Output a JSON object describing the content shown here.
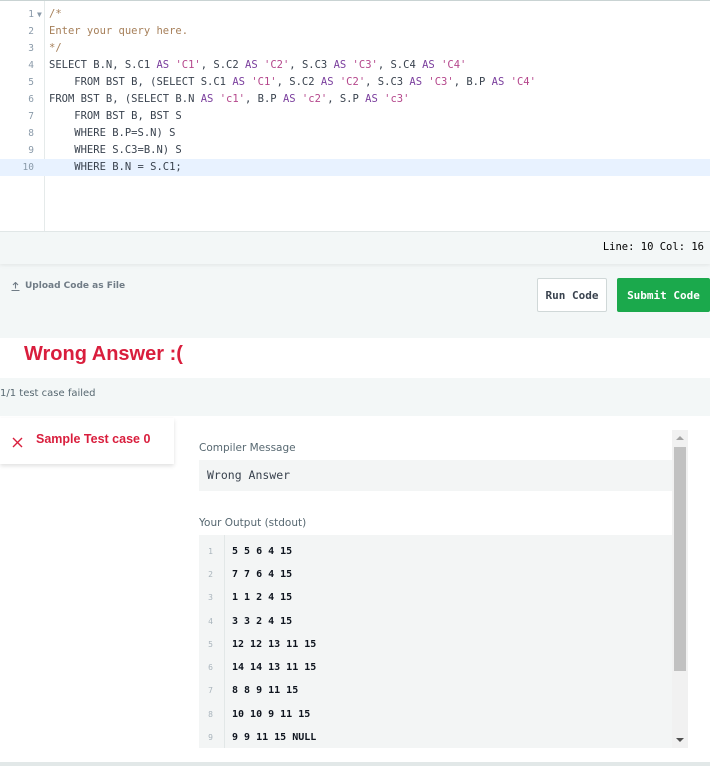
{
  "editor": {
    "lines": [
      {
        "num": "1",
        "segments": [
          {
            "t": "/*",
            "c": "comment"
          }
        ]
      },
      {
        "num": "2",
        "segments": [
          {
            "t": "Enter your query here.",
            "c": "comment"
          }
        ]
      },
      {
        "num": "3",
        "segments": [
          {
            "t": "*/",
            "c": "comment"
          }
        ]
      },
      {
        "num": "4",
        "segments": [
          {
            "t": "SELECT B.N, S.C1 ",
            "c": "kw"
          },
          {
            "t": "AS",
            "c": "kw2"
          },
          {
            "t": " ",
            "c": "kw"
          },
          {
            "t": "'C1'",
            "c": "str"
          },
          {
            "t": ", S.C2 ",
            "c": "kw"
          },
          {
            "t": "AS",
            "c": "kw2"
          },
          {
            "t": " ",
            "c": "kw"
          },
          {
            "t": "'C2'",
            "c": "str"
          },
          {
            "t": ", S.C3 ",
            "c": "kw"
          },
          {
            "t": "AS",
            "c": "kw2"
          },
          {
            "t": " ",
            "c": "kw"
          },
          {
            "t": "'C3'",
            "c": "str"
          },
          {
            "t": ", S.C4 ",
            "c": "kw"
          },
          {
            "t": "AS",
            "c": "kw2"
          },
          {
            "t": " ",
            "c": "kw"
          },
          {
            "t": "'C4'",
            "c": "str"
          }
        ]
      },
      {
        "num": "5",
        "segments": [
          {
            "t": "    FROM BST B, (SELECT S.C1 ",
            "c": "kw"
          },
          {
            "t": "AS",
            "c": "kw2"
          },
          {
            "t": " ",
            "c": "kw"
          },
          {
            "t": "'C1'",
            "c": "str"
          },
          {
            "t": ", S.C2 ",
            "c": "kw"
          },
          {
            "t": "AS",
            "c": "kw2"
          },
          {
            "t": " ",
            "c": "kw"
          },
          {
            "t": "'C2'",
            "c": "str"
          },
          {
            "t": ", S.C3 ",
            "c": "kw"
          },
          {
            "t": "AS",
            "c": "kw2"
          },
          {
            "t": " ",
            "c": "kw"
          },
          {
            "t": "'C3'",
            "c": "str"
          },
          {
            "t": ", B.P ",
            "c": "kw"
          },
          {
            "t": "AS",
            "c": "kw2"
          },
          {
            "t": " ",
            "c": "kw"
          },
          {
            "t": "'C4'",
            "c": "str"
          }
        ]
      },
      {
        "num": "6",
        "segments": [
          {
            "t": "FROM BST B, (SELECT B.N ",
            "c": "kw"
          },
          {
            "t": "AS",
            "c": "kw2"
          },
          {
            "t": " ",
            "c": "kw"
          },
          {
            "t": "'c1'",
            "c": "str"
          },
          {
            "t": ", B.P ",
            "c": "kw"
          },
          {
            "t": "AS",
            "c": "kw2"
          },
          {
            "t": " ",
            "c": "kw"
          },
          {
            "t": "'c2'",
            "c": "str"
          },
          {
            "t": ", S.P ",
            "c": "kw"
          },
          {
            "t": "AS",
            "c": "kw2"
          },
          {
            "t": " ",
            "c": "kw"
          },
          {
            "t": "'c3'",
            "c": "str"
          }
        ]
      },
      {
        "num": "7",
        "segments": [
          {
            "t": "    FROM BST B, BST S",
            "c": "kw"
          }
        ]
      },
      {
        "num": "8",
        "segments": [
          {
            "t": "    WHERE B.P=S.N) S",
            "c": "kw"
          }
        ]
      },
      {
        "num": "9",
        "segments": [
          {
            "t": "    WHERE S.C3=B.N) S",
            "c": "kw"
          }
        ]
      },
      {
        "num": "10",
        "segments": [
          {
            "t": "    WHERE B.N = S.C1;",
            "c": "kw"
          }
        ]
      }
    ],
    "active_line": 10,
    "status": "Line: 10 Col: 16"
  },
  "toolbar": {
    "upload_label": "Upload Code as File",
    "run_label": "Run Code",
    "submit_label": "Submit Code"
  },
  "result": {
    "title": "Wrong Answer :(",
    "summary": "1/1 test case failed"
  },
  "testcase": {
    "name": "Sample Test case 0",
    "compiler_label": "Compiler Message",
    "compiler_message": "Wrong Answer",
    "output_label": "Your Output (stdout)",
    "output_lines": [
      {
        "num": "1",
        "text": "5 5 6 4 15"
      },
      {
        "num": "2",
        "text": "7 7 6 4 15"
      },
      {
        "num": "3",
        "text": "1 1 2 4 15"
      },
      {
        "num": "4",
        "text": "3 3 2 4 15"
      },
      {
        "num": "5",
        "text": "12 12 13 11 15"
      },
      {
        "num": "6",
        "text": "14 14 13 11 15"
      },
      {
        "num": "7",
        "text": "8 8 9 11 15"
      },
      {
        "num": "8",
        "text": "10 10 9 11 15"
      },
      {
        "num": "9",
        "text": "9 9 11 15 NULL"
      }
    ]
  },
  "colors": {
    "error_red": "#d91e3d",
    "submit_green": "#1ba94c"
  }
}
